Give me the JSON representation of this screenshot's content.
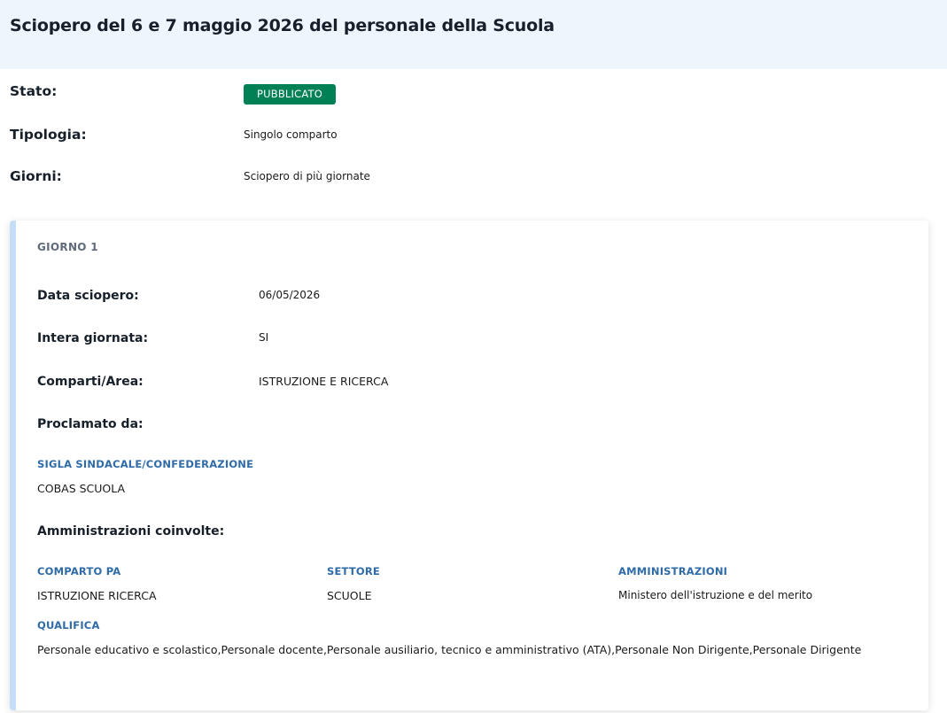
{
  "header": {
    "title": "Sciopero del 6 e 7 maggio 2026 del personale della Scuola"
  },
  "meta": {
    "stato_label": "Stato:",
    "stato_value": "PUBBLICATO",
    "tipologia_label": "Tipologia:",
    "tipologia_value": "Singolo comparto",
    "giorni_label": "Giorni:",
    "giorni_value": "Sciopero di più giornate"
  },
  "day": {
    "title": "GIORNO 1",
    "data_label": "Data sciopero:",
    "data_value": "06/05/2026",
    "intera_label": "Intera giornata:",
    "intera_value": "SI",
    "comparti_label": "Comparti/Area:",
    "comparti_value": "ISTRUZIONE E RICERCA",
    "proclamato_label": "Proclamato da:",
    "sigla_head": "SIGLA SINDACALE/CONFEDERAZIONE",
    "sigla_value": "COBAS SCUOLA",
    "amministrazioni_label": "Amministrazioni coinvolte:",
    "comparto_pa_head": "COMPARTO PA",
    "comparto_pa_value": "ISTRUZIONE RICERCA",
    "settore_head": "SETTORE",
    "settore_value": "SCUOLE",
    "amministrazioni_head": "AMMINISTRAZIONI",
    "amministrazioni_value": "Ministero dell'istruzione e del merito",
    "qualifica_head": "QUALIFICA",
    "qualifica_value": "Personale educativo e scolastico,Personale docente,Personale ausiliario, tecnico e amministrativo (ATA),Personale Non Dirigente,Personale Dirigente"
  },
  "colors": {
    "header_bg": "#eff5fd",
    "badge_green": "#008055",
    "accent_blue": "#c6ddf7",
    "heading_blue": "#2e6ba7"
  }
}
